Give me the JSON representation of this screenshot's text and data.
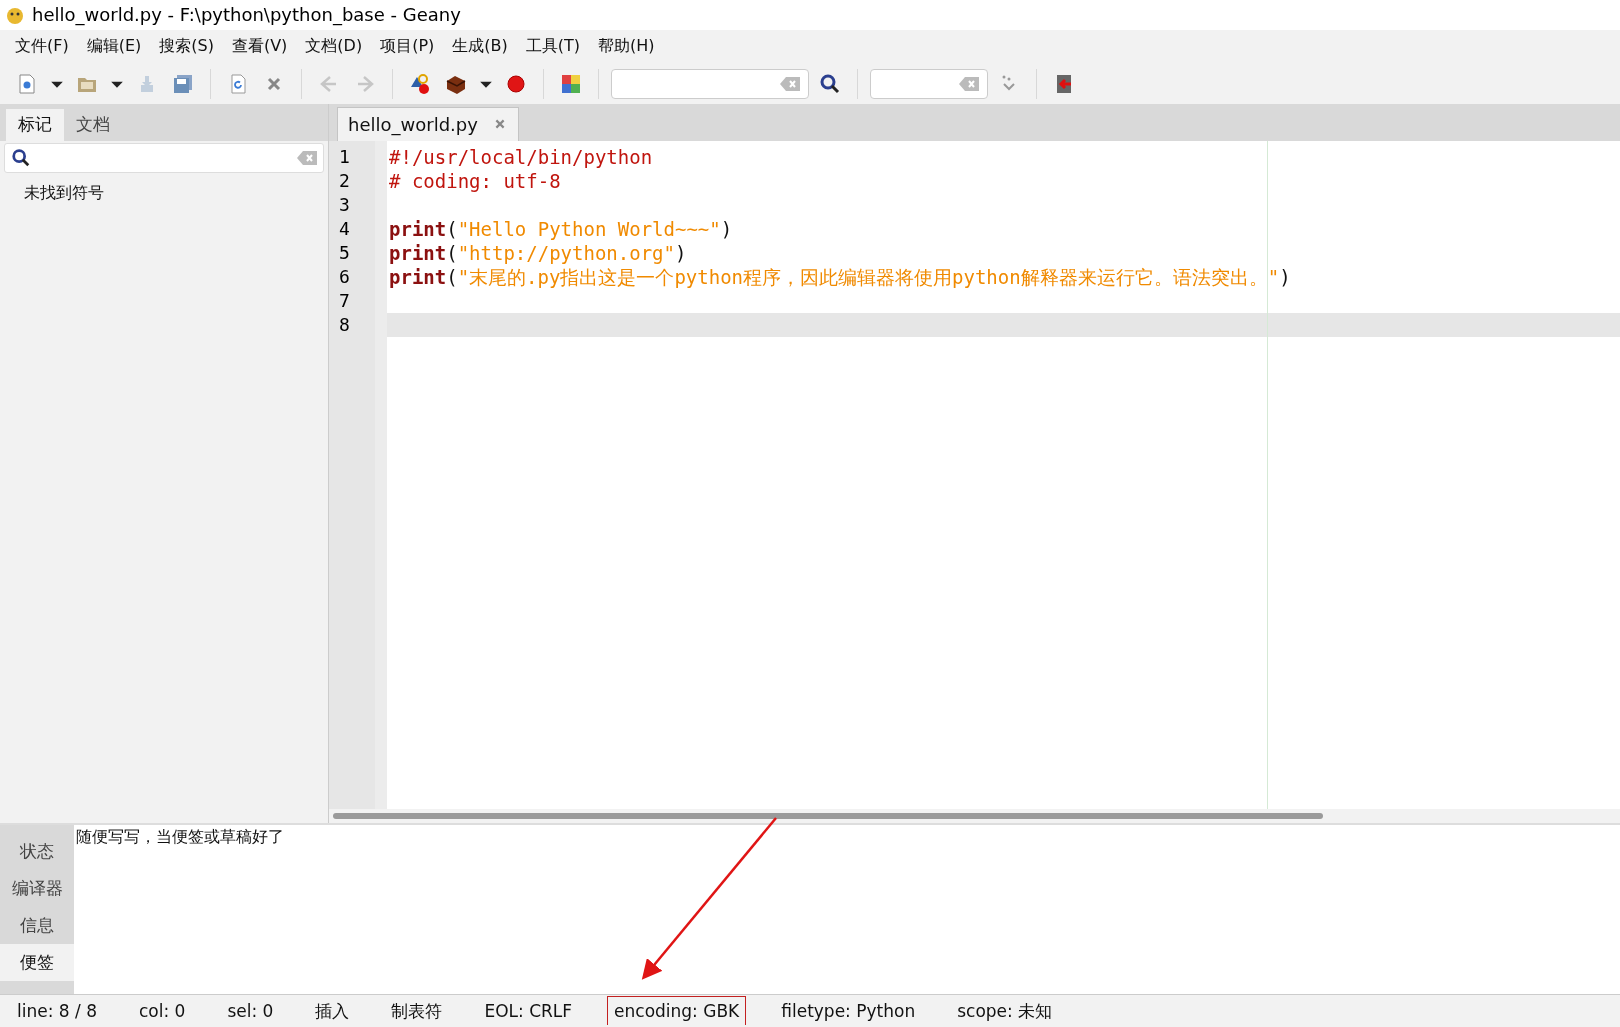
{
  "window": {
    "title": "hello_world.py - F:\\python\\python_base - Geany"
  },
  "menu": [
    "文件(F)",
    "编辑(E)",
    "搜索(S)",
    "查看(V)",
    "文档(D)",
    "项目(P)",
    "生成(B)",
    "工具(T)",
    "帮助(H)"
  ],
  "toolbar": [
    {
      "kind": "new",
      "disabled": false
    },
    {
      "kind": "caret",
      "disabled": false
    },
    {
      "kind": "open",
      "disabled": false
    },
    {
      "kind": "caret",
      "disabled": false
    },
    {
      "kind": "save",
      "disabled": true
    },
    {
      "kind": "saveall",
      "disabled": false
    },
    {
      "kind": "sep"
    },
    {
      "kind": "reload",
      "disabled": false
    },
    {
      "kind": "close",
      "disabled": false
    },
    {
      "kind": "sep"
    },
    {
      "kind": "back",
      "disabled": true
    },
    {
      "kind": "forward",
      "disabled": true
    },
    {
      "kind": "sep"
    },
    {
      "kind": "compile",
      "disabled": false
    },
    {
      "kind": "build",
      "disabled": false
    },
    {
      "kind": "caret",
      "disabled": false
    },
    {
      "kind": "stop",
      "disabled": false
    },
    {
      "kind": "sep"
    },
    {
      "kind": "color",
      "disabled": false
    },
    {
      "kind": "sep"
    },
    {
      "kind": "searchfield",
      "disabled": false
    },
    {
      "kind": "search",
      "disabled": false
    },
    {
      "kind": "sep"
    },
    {
      "kind": "gotofield",
      "disabled": false
    },
    {
      "kind": "jump",
      "disabled": false
    },
    {
      "kind": "sep"
    },
    {
      "kind": "quit",
      "disabled": false
    }
  ],
  "sidebar": {
    "tabs": [
      {
        "label": "标记",
        "selected": true
      },
      {
        "label": "文档",
        "selected": false
      }
    ],
    "message": "未找到符号"
  },
  "editor": {
    "tabs": [
      {
        "label": "hello_world.py",
        "selected": true
      }
    ],
    "lines": [
      {
        "number": "1",
        "current": false,
        "tokens": [
          {
            "kind": "comment",
            "text": "#!/usr/local/bin/python"
          }
        ]
      },
      {
        "number": "2",
        "current": false,
        "tokens": [
          {
            "kind": "comment",
            "text": "# coding: utf-8"
          }
        ]
      },
      {
        "number": "3",
        "current": false
      },
      {
        "number": "4",
        "current": false,
        "tokens": [
          {
            "kind": "keyword",
            "text": "print"
          },
          {
            "kind": "plain",
            "text": "("
          },
          {
            "kind": "string",
            "text": "\"Hello Python World~~~\""
          },
          {
            "kind": "plain",
            "text": ")"
          }
        ]
      },
      {
        "number": "5",
        "current": false,
        "tokens": [
          {
            "kind": "keyword",
            "text": "print"
          },
          {
            "kind": "plain",
            "text": "("
          },
          {
            "kind": "string",
            "text": "\"http://python.org\""
          },
          {
            "kind": "plain",
            "text": ")"
          }
        ]
      },
      {
        "number": "6",
        "current": false,
        "tokens": [
          {
            "kind": "keyword",
            "text": "print"
          },
          {
            "kind": "plain",
            "text": "("
          },
          {
            "kind": "string",
            "text": "\"末尾的.py指出这是一个python程序，因此编辑器将使用python解释器来运行它。语法突出。\""
          },
          {
            "kind": "plain",
            "text": ")"
          }
        ]
      },
      {
        "number": "7",
        "current": false
      },
      {
        "number": "8",
        "current": true
      }
    ]
  },
  "message_panel": {
    "tabs": [
      {
        "label": "状态",
        "selected": false
      },
      {
        "label": "编译器",
        "selected": false
      },
      {
        "label": "信息",
        "selected": false
      },
      {
        "label": "便签",
        "selected": true
      }
    ],
    "text": "随便写写，当便签或草稿好了"
  },
  "status_bar": [
    {
      "text": "line: 8 / 8",
      "highlighted": false
    },
    {
      "text": "col: 0",
      "highlighted": false
    },
    {
      "text": "sel: 0",
      "highlighted": false
    },
    {
      "text": "插入",
      "highlighted": false
    },
    {
      "text": "制表符",
      "highlighted": false
    },
    {
      "text": "EOL: CRLF",
      "highlighted": false
    },
    {
      "text": "encoding: GBK",
      "highlighted": true
    },
    {
      "text": "filetype: Python",
      "highlighted": false
    },
    {
      "text": "scope: 未知",
      "highlighted": false
    }
  ]
}
